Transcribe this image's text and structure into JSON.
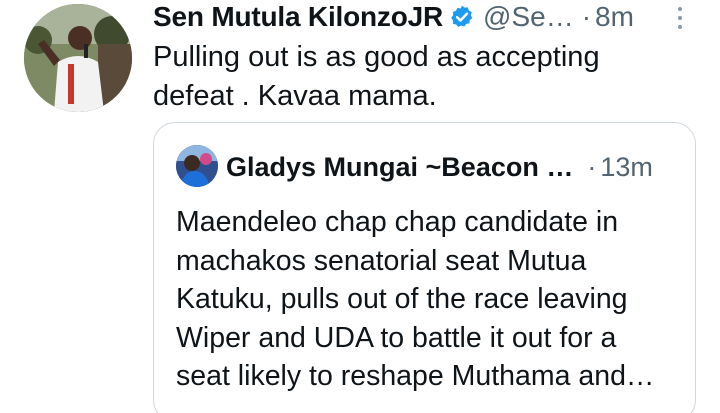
{
  "tweet": {
    "author_name": "Sen Mutula KilonzoJR",
    "handle": "@Se…",
    "separator": "·",
    "time": "8m",
    "text": "Pulling out is as good as accepting\ndefeat . Kavaa mama.",
    "verified_color": "#1d9bf0"
  },
  "quoted_tweet": {
    "author_name": "Gladys Mungai ~Beacon …",
    "separator": "·",
    "time": "13m",
    "text": "Maendeleo chap chap candidate in\nmachakos senatorial seat Mutua\nKatuku, pulls out of the race leaving\nWiper and UDA to battle it out for a\nseat likely to reshape Muthama and…"
  },
  "icons": {
    "verified": "verified-badge-icon",
    "more": "more-options-icon"
  },
  "colors": {
    "text_primary": "#0f1419",
    "text_secondary": "#536471",
    "border": "#cfd9de"
  }
}
